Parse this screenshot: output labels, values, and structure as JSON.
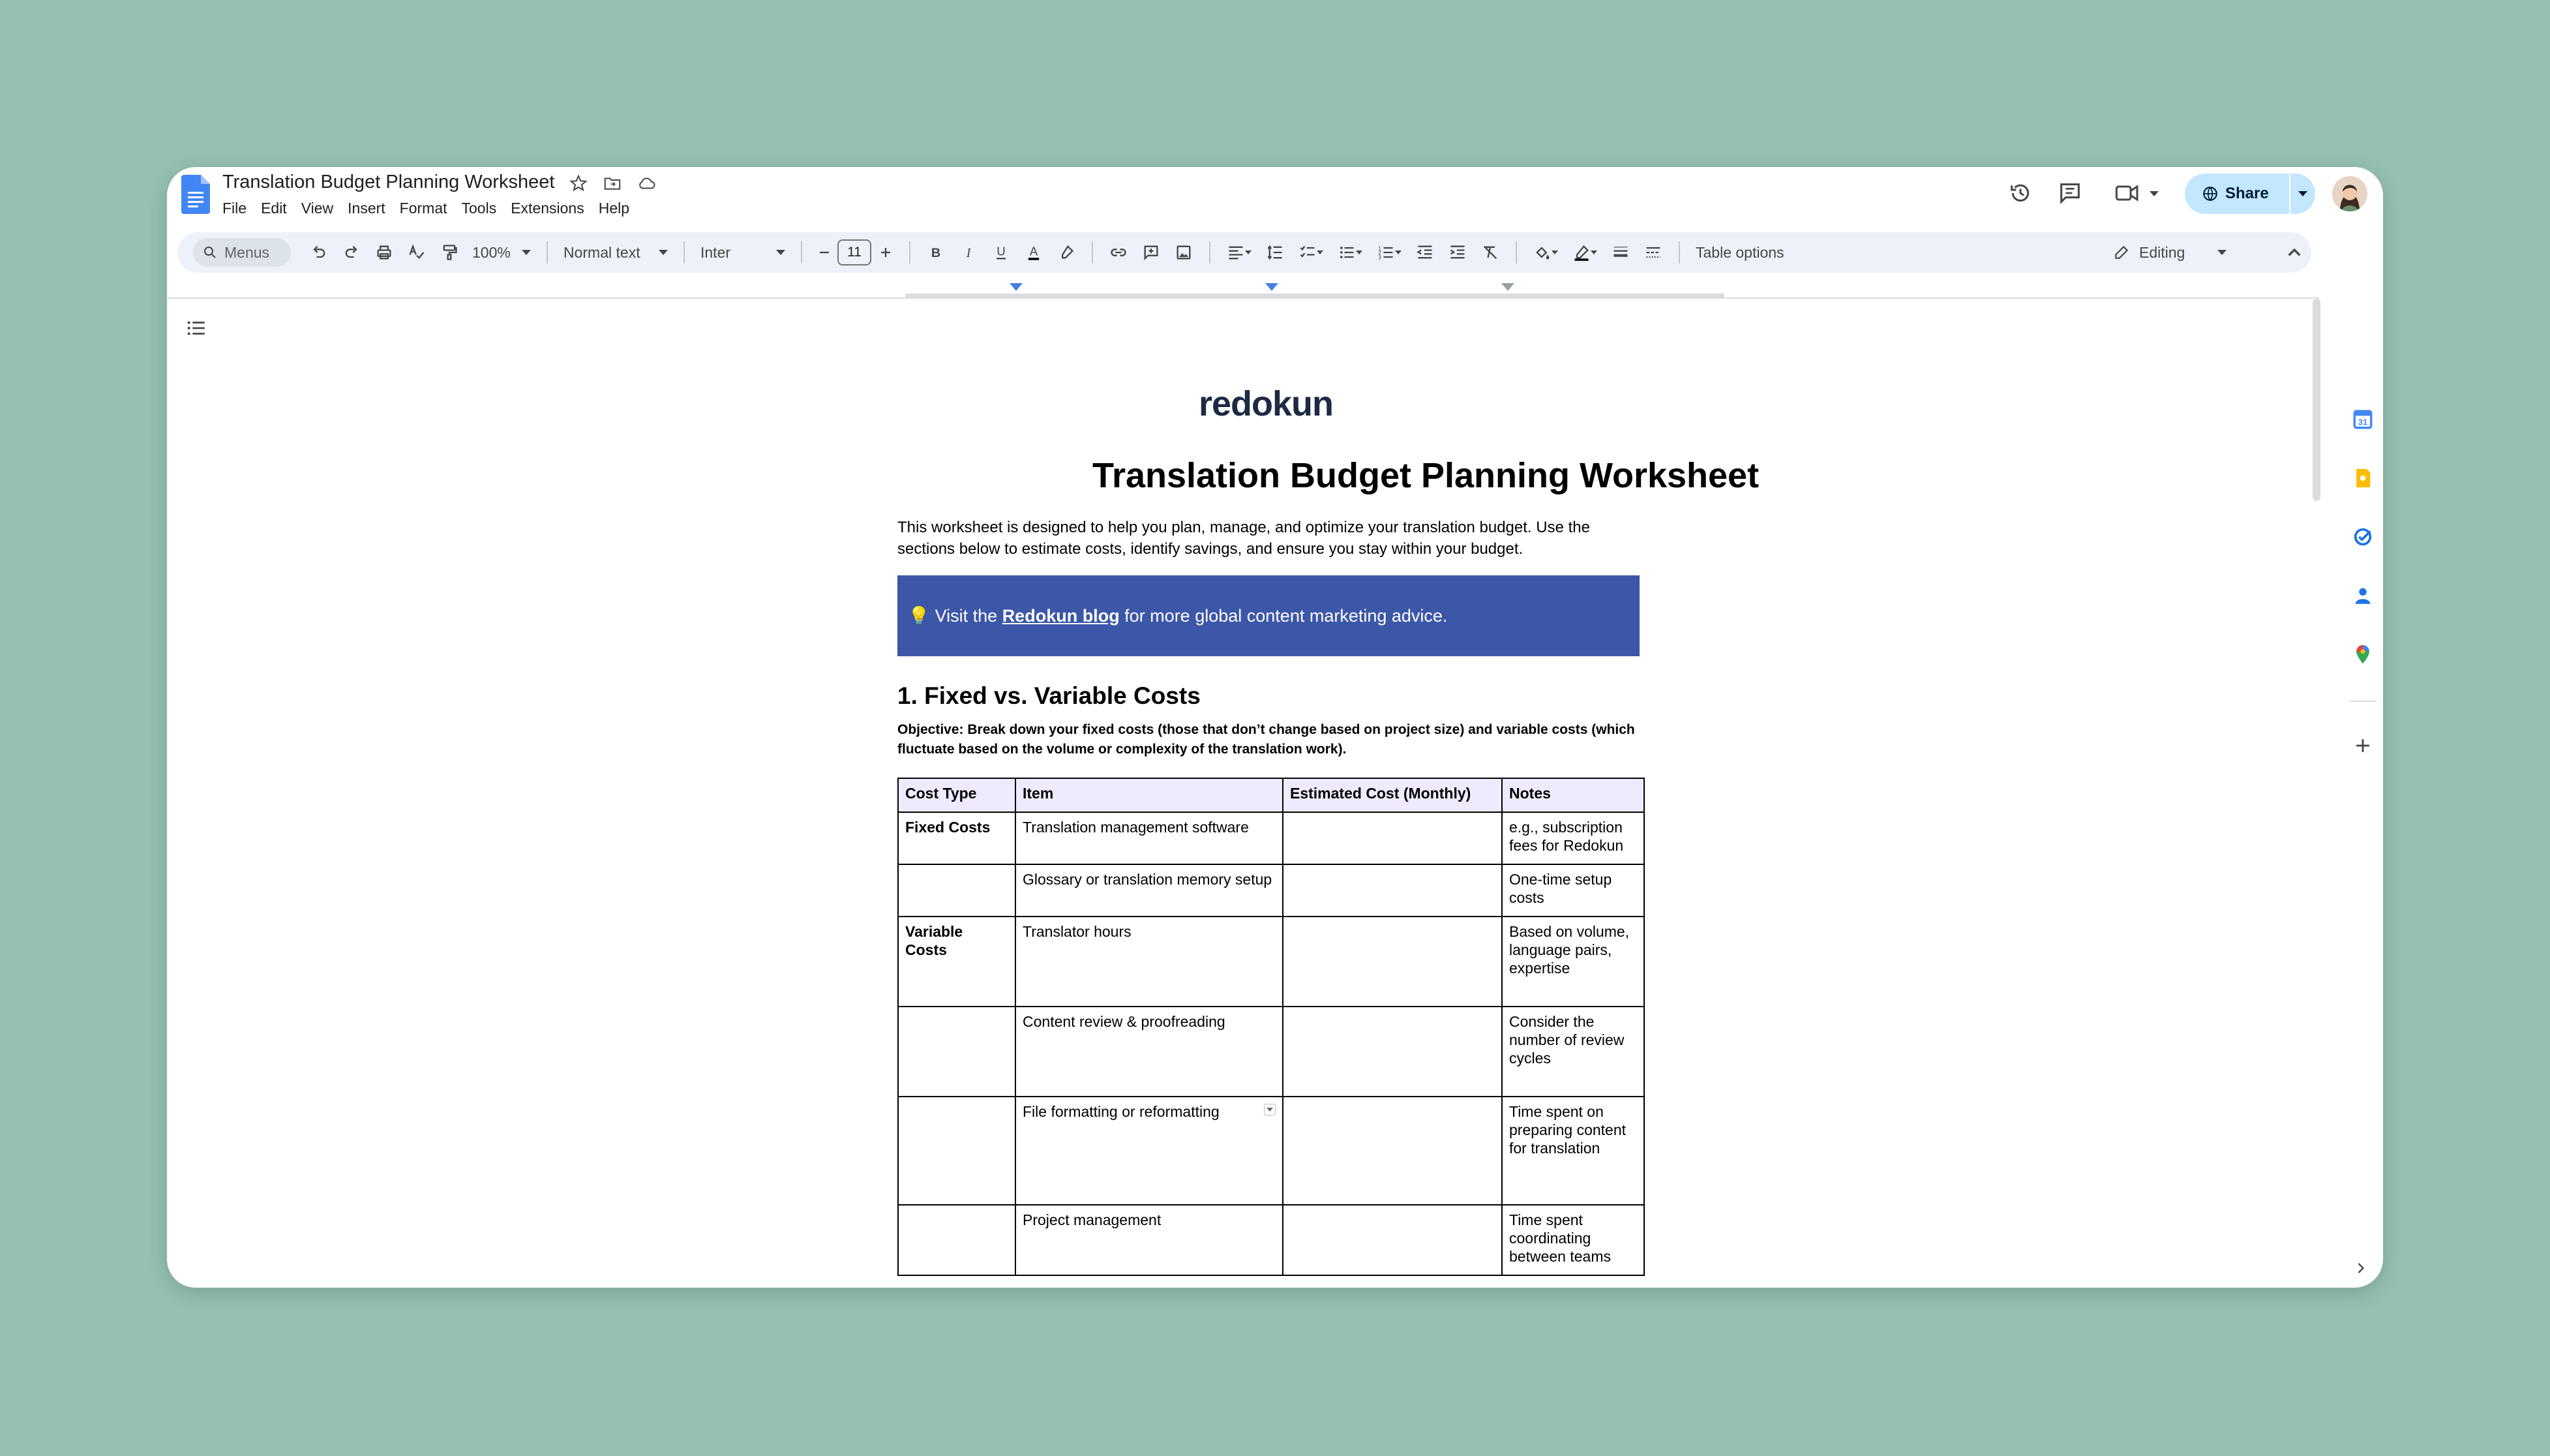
{
  "app": {
    "doc_title": "Translation Budget Planning Worksheet",
    "menus": [
      "File",
      "Edit",
      "View",
      "Insert",
      "Format",
      "Tools",
      "Extensions",
      "Help"
    ],
    "share_label": "Share",
    "accent_color": "#c2e7ff"
  },
  "toolbar": {
    "search_placeholder": "Menus",
    "zoom": "100%",
    "style": "Normal text",
    "font": "Inter",
    "font_size": "11",
    "table_options": "Table options",
    "mode": "Editing"
  },
  "document": {
    "logo": "redokun",
    "title": "Translation Budget Planning Worksheet",
    "intro": "This worksheet is designed to help you plan, manage, and optimize your translation budget. Use the sections below to estimate costs, identify savings, and ensure you stay within your budget.",
    "callout": {
      "icon": "💡",
      "prefix": "Visit the ",
      "link": "Redokun blog",
      "suffix": " for more global content marketing advice.",
      "color": "#3c56a8"
    },
    "section1": {
      "heading": "1. Fixed vs. Variable Costs",
      "objective": "Objective: Break down your fixed costs (those that don’t change based on project size) and variable costs (which fluctuate based on the volume or complexity of the translation work).",
      "headers": [
        "Cost Type",
        "Item",
        "Estimated Cost (Monthly)",
        "Notes"
      ],
      "rows": [
        {
          "type": "Fixed Costs",
          "item": "Translation management software",
          "cost": "",
          "notes": "e.g., subscription fees for Redokun"
        },
        {
          "type": "",
          "item": "Glossary or translation memory setup",
          "cost": "",
          "notes": "One-time setup costs"
        },
        {
          "type": "Variable Costs",
          "item": "Translator hours",
          "cost": "",
          "notes": "Based on volume, language pairs, expertise"
        },
        {
          "type": "",
          "item": "Content review & proofreading",
          "cost": "",
          "notes": "Consider the number of review cycles"
        },
        {
          "type": "",
          "item": "File formatting or reformatting",
          "cost": "",
          "notes": "Time spent on preparing content for translation"
        },
        {
          "type": "",
          "item": "Project management",
          "cost": "",
          "notes": "Time spent coordinating between teams"
        }
      ]
    }
  }
}
